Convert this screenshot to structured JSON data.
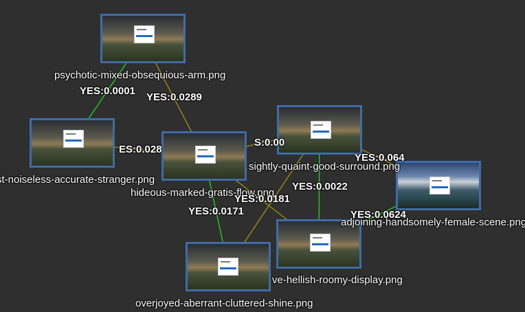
{
  "nodes": [
    {
      "id": "n1",
      "filename": "psychotic-mixed-obsequious-arm.png"
    },
    {
      "id": "n2",
      "filename": "st-noiseless-accurate-stranger.png"
    },
    {
      "id": "n3",
      "filename": "hideous-marked-gratis-flow.png"
    },
    {
      "id": "n4",
      "filename": "sightly-quaint-good-surround.png"
    },
    {
      "id": "n5",
      "filename": "adjoining-handsomely-female-scene.png"
    },
    {
      "id": "n6",
      "filename": "ve-hellish-roomy-display.png"
    },
    {
      "id": "n7",
      "filename": "overjoyed-aberrant-cluttered-shine.png"
    }
  ],
  "edges": [
    {
      "from": "n1",
      "to": "n2",
      "label": "YES:0.0001",
      "color": "#22cc22"
    },
    {
      "from": "n1",
      "to": "n3",
      "label": "YES:0.0289",
      "color": "#9a8a1a"
    },
    {
      "from": "n2",
      "to": "n3",
      "label": "ES:0.028",
      "color": "#9a8a1a"
    },
    {
      "from": "n3",
      "to": "n4",
      "label": "S:0.00",
      "color": "#9a8a1a"
    },
    {
      "from": "n4",
      "to": "n5",
      "label": "YES:0.064",
      "color": "#9a8a1a"
    },
    {
      "from": "n4",
      "to": "n6",
      "label": "YES:0.0022",
      "color": "#22cc22"
    },
    {
      "from": "n3",
      "to": "n6",
      "label": "YES:0.0181",
      "color": "#9a8a1a"
    },
    {
      "from": "n5",
      "to": "n6",
      "label": "YES:0.0624",
      "color": "#22cc22"
    },
    {
      "from": "n3",
      "to": "n7",
      "label": "YES:0.0171",
      "color": "#22cc22"
    },
    {
      "from": "n4",
      "to": "n7",
      "label": "",
      "color": "#9a8a1a"
    }
  ]
}
